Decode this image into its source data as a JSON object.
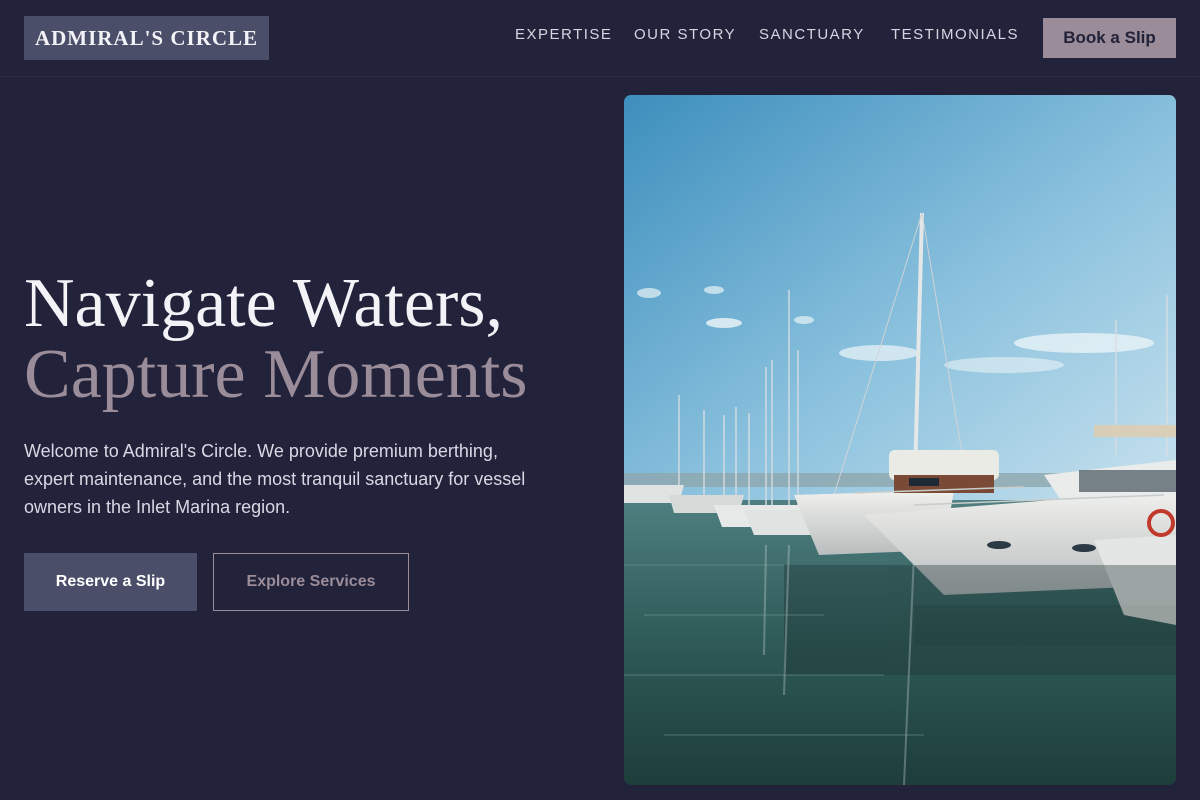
{
  "brand": {
    "name": "ADMIRAL'S CIRCLE"
  },
  "nav": {
    "items": [
      {
        "label": "EXPERTISE"
      },
      {
        "label": "OUR STORY"
      },
      {
        "label": "SANCTUARY"
      },
      {
        "label": "TESTIMONIALS"
      }
    ],
    "cta_label": "Book a Slip"
  },
  "hero": {
    "headline_line1": "Navigate Waters,",
    "headline_line2": "Capture Moments",
    "intro": "Welcome to Admiral's Circle. We provide premium berthing, expert maintenance, and the most tranquil sanctuary for vessel owners in the Inlet Marina region.",
    "primary_cta": "Reserve a Slip",
    "secondary_cta": "Explore Services"
  },
  "colors": {
    "background": "#22223b",
    "accent": "#4a4e69",
    "muted_accent": "#9a8c98"
  },
  "image": {
    "subject": "marina-yachts-photo"
  }
}
